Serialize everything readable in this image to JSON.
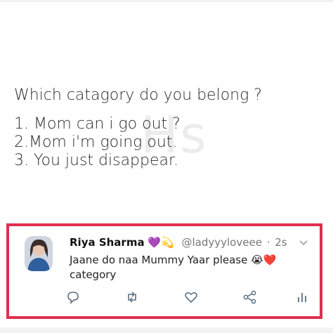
{
  "post": {
    "question": "Which catagory do you belong ?",
    "options": [
      "1. Mom can i go out ?",
      "2.Mom i'm going out.",
      "3. You just disappear."
    ]
  },
  "tweet": {
    "name": "Riya Sharma",
    "name_emojis": "💜💫",
    "handle": "@ladyyyloveee",
    "separator": "·",
    "time": "2s",
    "text_line1": "Jaane do naa Mummy Yaar please 😭❤️",
    "text_line2": "category",
    "highlight_color": "#e02e4f"
  },
  "icons": [
    "chevron-down-icon",
    "reply-icon",
    "retweet-icon",
    "like-icon",
    "share-icon",
    "analytics-icon"
  ]
}
